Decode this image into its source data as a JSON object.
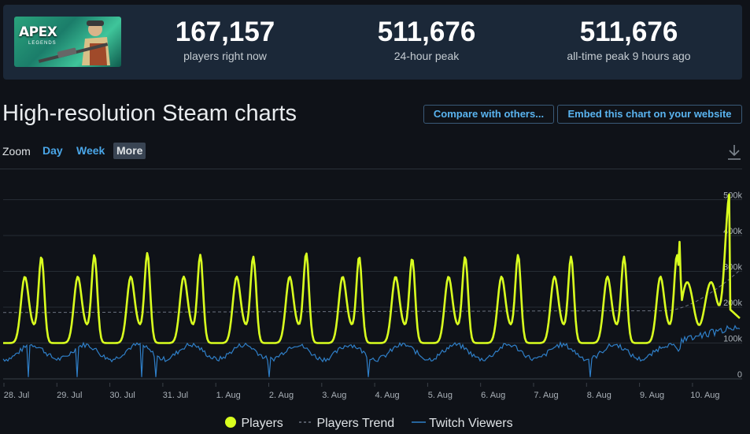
{
  "header": {
    "game_logo_text": "APEX",
    "game_logo_sub": "LEGENDS",
    "stats": [
      {
        "value": "167,157",
        "label": "players right now"
      },
      {
        "value": "511,676",
        "label": "24-hour peak"
      },
      {
        "value": "511,676",
        "label": "all-time peak 9 hours ago"
      }
    ]
  },
  "title": "High-resolution Steam charts",
  "buttons": {
    "compare": "Compare with others...",
    "embed": "Embed this chart on your website"
  },
  "zoom": {
    "label": "Zoom",
    "options": [
      "Day",
      "Week",
      "More"
    ],
    "selected": "More"
  },
  "colors": {
    "players": "#d9ff1f",
    "trend": "#6b7280",
    "twitch": "#2f7fc8",
    "accent": "#5ab4f0"
  },
  "chart_data": {
    "type": "line",
    "x_labels": [
      "28. Jul",
      "29. Jul",
      "30. Jul",
      "31. Jul",
      "1. Aug",
      "2. Aug",
      "3. Aug",
      "4. Aug",
      "5. Aug",
      "6. Aug",
      "7. Aug",
      "8. Aug",
      "9. Aug",
      "10. Aug"
    ],
    "y_ticks": [
      "0",
      "100k",
      "200k",
      "300k",
      "400k",
      "500k"
    ],
    "ylim": [
      0,
      520000
    ],
    "grid": true,
    "legend_position": "bottom-center",
    "series": [
      {
        "name": "Players",
        "style": "solid",
        "peaks": [
          330000,
          335000,
          340000,
          335000,
          330000,
          340000,
          330000,
          325000,
          330000,
          335000,
          330000,
          330000,
          335000,
          511676
        ],
        "troughs": [
          100000,
          100000,
          100000,
          100000,
          100000,
          100000,
          100000,
          100000,
          100000,
          100000,
          100000,
          100000,
          100000,
          100000
        ],
        "current": 167157
      },
      {
        "name": "Players Trend",
        "style": "dashed",
        "start": 185000,
        "mid": 190000,
        "end": 305000
      },
      {
        "name": "Twitch Viewers",
        "style": "solid",
        "typical_low": 55000,
        "typical_high": 95000,
        "end_high": 150000
      }
    ]
  }
}
